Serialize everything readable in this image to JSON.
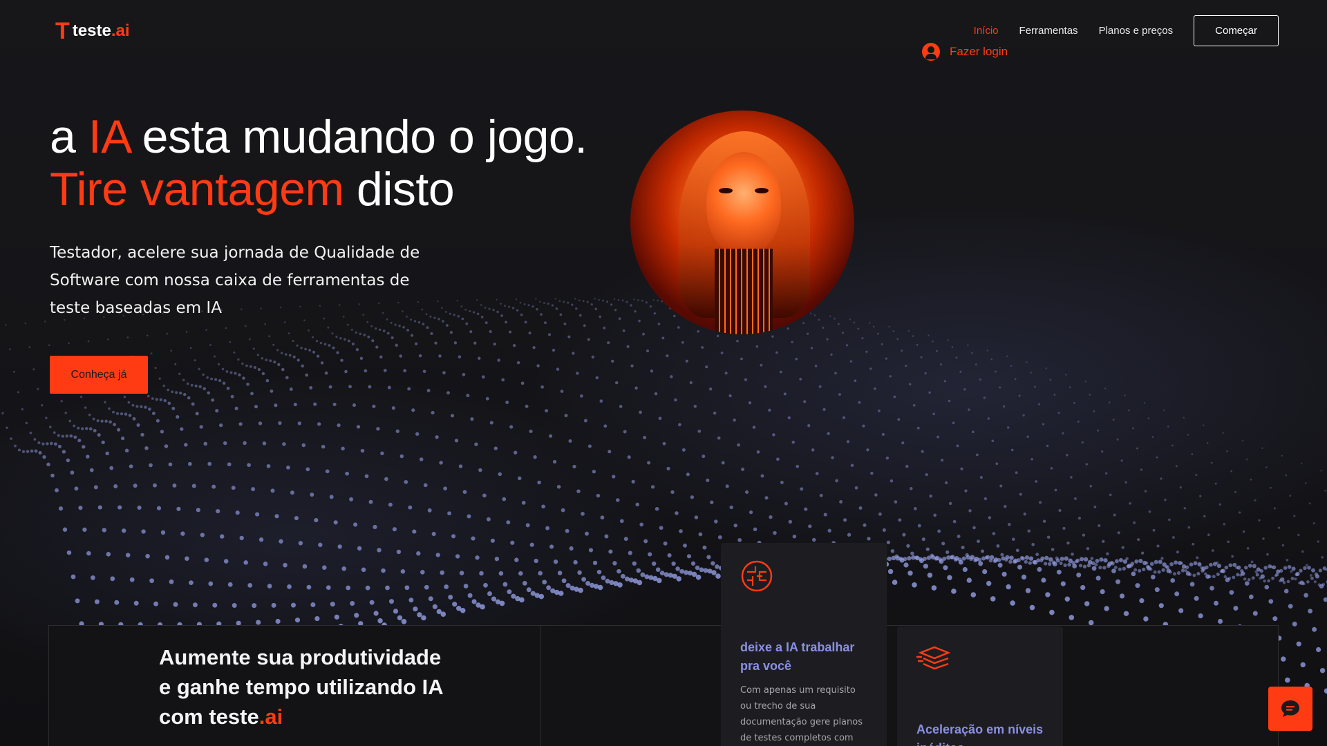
{
  "brand": {
    "logo_mark": "T",
    "name_main": "teste",
    "name_suffix": ".ai"
  },
  "nav": {
    "items": [
      {
        "label": "Início",
        "active": true
      },
      {
        "label": "Ferramentas",
        "active": false
      },
      {
        "label": "Planos e preços",
        "active": false
      }
    ],
    "cta": "Começar",
    "login": "Fazer login"
  },
  "hero": {
    "title_pre": "a ",
    "title_ia": "IA",
    "title_rest": " esta mudando o jogo.",
    "title_l2_orange": "Tire vantagem",
    "title_l2_rest": " disto",
    "subtitle": "Testador, acelere sua jornada de Qualidade de Software com nossa caixa de ferramentas de teste baseadas em IA",
    "cta": "Conheça já"
  },
  "section": {
    "heading_main": "Aumente sua produtividade e ganhe tempo utilizando IA com teste",
    "heading_suffix": ".ai"
  },
  "cards": [
    {
      "icon": "circuit-brain-icon",
      "title": "deixe a IA trabalhar pra você",
      "text": "Com apenas um requisito ou trecho de sua documentação gere planos de testes completos com"
    },
    {
      "icon": "layers-speed-icon",
      "title": "Aceleração em níveis inéditos"
    }
  ],
  "colors": {
    "accent": "#ff3b14",
    "card_title": "#8a8fe6",
    "background": "#141416"
  },
  "chat": {
    "icon": "chat-bubble-icon"
  }
}
